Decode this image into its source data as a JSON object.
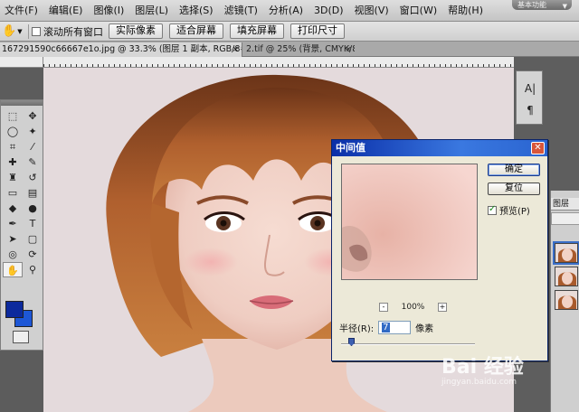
{
  "menu": {
    "items": [
      "文件(F)",
      "编辑(E)",
      "图像(I)",
      "图层(L)",
      "选择(S)",
      "滤镜(T)",
      "分析(A)",
      "3D(D)",
      "视图(V)",
      "窗口(W)",
      "帮助(H)"
    ],
    "workspace": "基本功能"
  },
  "options": {
    "tool_icon": "hand-icon",
    "scroll_all_label": "滚动所有窗口",
    "btn_actual": "实际像素",
    "btn_fit": "适合屏幕",
    "btn_fill": "填充屏幕",
    "btn_print": "打印尺寸"
  },
  "tabs": {
    "active": "167291590c66667e1o.jpg @ 33.3% (图层 1 副本, RGB/8#) *",
    "inactive": "2.tif @ 25% (背景, CMYK/8)"
  },
  "colors": {
    "foreground": "#0c2a9c",
    "background": "#1d57d6",
    "title_bar": "#0a2ea8"
  },
  "dock": {
    "char_icon_1": "A|",
    "char_icon_2": "¶",
    "layers_tab": "图层"
  },
  "dialog": {
    "title": "中间值",
    "ok": "确定",
    "reset": "复位",
    "preview_label": "预览(P)",
    "zoom_minus": "-",
    "zoom_level": "100%",
    "zoom_plus": "+",
    "radius_label": "半径(R):",
    "radius_value": "7",
    "radius_unit": "像素"
  },
  "watermark": {
    "brand": "Bai 经验",
    "url": "jingyan.baidu.com"
  }
}
